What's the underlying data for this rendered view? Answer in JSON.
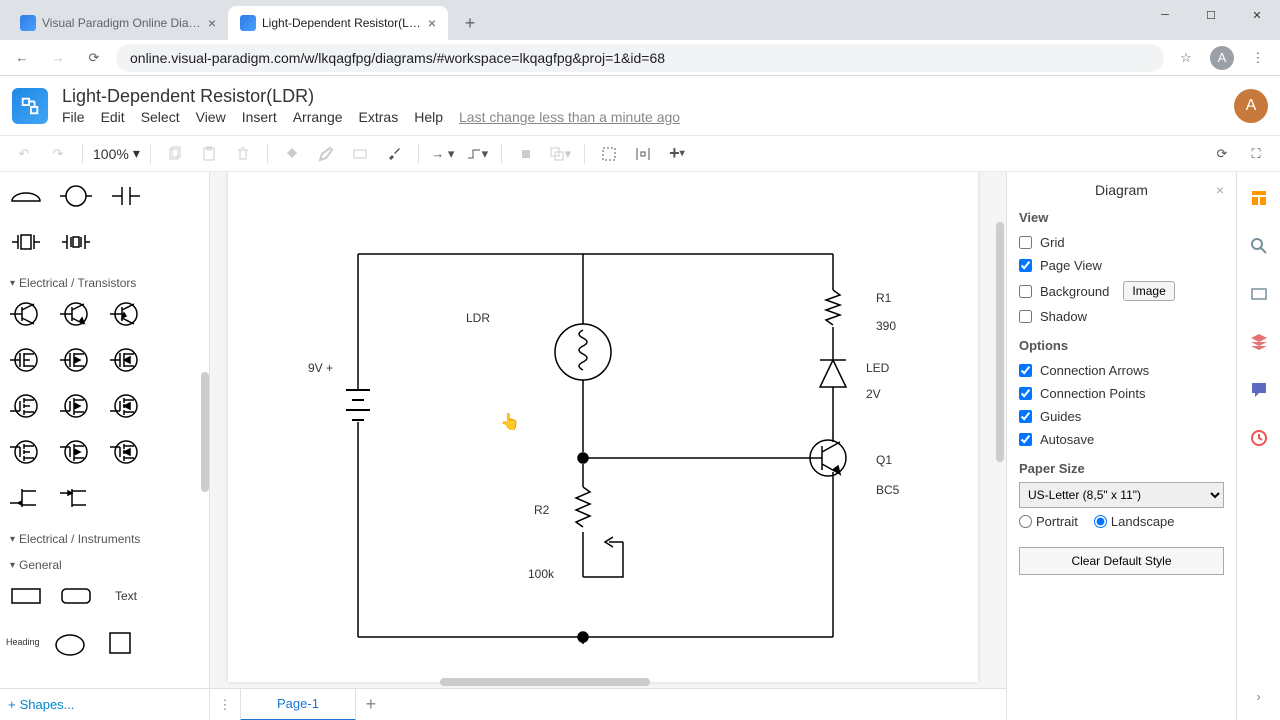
{
  "browser": {
    "tabs": [
      {
        "title": "Visual Paradigm Online Diagram",
        "active": false
      },
      {
        "title": "Light-Dependent Resistor(LDR)",
        "active": true
      }
    ],
    "url": "online.visual-paradigm.com/w/lkqagfpg/diagrams/#workspace=lkqagfpg&proj=1&id=68",
    "avatar": "A"
  },
  "app": {
    "doc_title": "Light-Dependent Resistor(LDR)",
    "menus": [
      "File",
      "Edit",
      "Select",
      "View",
      "Insert",
      "Arrange",
      "Extras",
      "Help"
    ],
    "last_change": "Last change less than a minute ago",
    "avatar": "A"
  },
  "toolbar": {
    "zoom": "100%"
  },
  "shapes_panel": {
    "categories": [
      "Electrical / Transistors",
      "Electrical / Instruments",
      "General"
    ],
    "text_label": "Text",
    "heading_label": "Heading",
    "shapes_button": "Shapes..."
  },
  "circuit": {
    "labels": {
      "ldr": "LDR",
      "v9": "9V +",
      "r1": "R1",
      "r1_val": "390",
      "led": "LED",
      "led_val": "2V",
      "q1": "Q1",
      "q1_val": "BC5",
      "r2": "R2",
      "r2_val": "100k"
    }
  },
  "page_tabs": {
    "page1": "Page-1"
  },
  "props": {
    "title": "Diagram",
    "view_label": "View",
    "grid": "Grid",
    "page_view": "Page View",
    "background": "Background",
    "image_btn": "Image",
    "shadow": "Shadow",
    "options_label": "Options",
    "conn_arrows": "Connection Arrows",
    "conn_points": "Connection Points",
    "guides": "Guides",
    "autosave": "Autosave",
    "paper_size_label": "Paper Size",
    "paper_size": "US-Letter (8,5\" x 11\")",
    "portrait": "Portrait",
    "landscape": "Landscape",
    "clear_default": "Clear Default Style"
  }
}
